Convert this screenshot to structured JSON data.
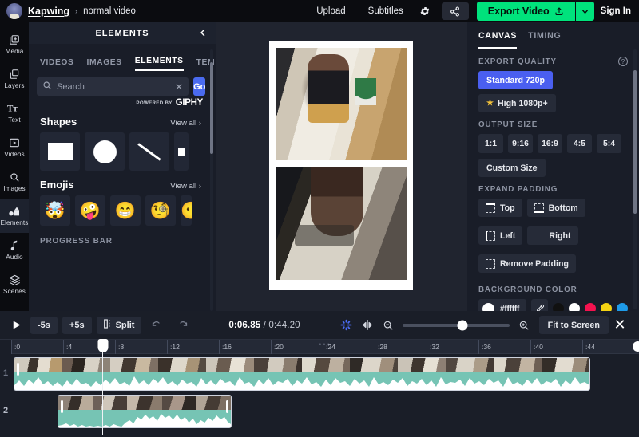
{
  "topbar": {
    "brand": "Kapwing",
    "separator": "›",
    "project_name": "normal video",
    "upload": "Upload",
    "subtitles": "Subtitles",
    "settings_icon": "gear-icon",
    "share_icon": "share-icon",
    "export_label": "Export Video",
    "export_icon": "export-upload-icon",
    "export_caret": "chevron-down-icon",
    "signin": "Sign In",
    "export_color": "#00e27c"
  },
  "rail": {
    "items": [
      {
        "label": "Media",
        "icon": "media-add-icon",
        "active": false
      },
      {
        "label": "Layers",
        "icon": "layers-icon",
        "active": false
      },
      {
        "label": "Text",
        "icon": "text-icon",
        "active": false
      },
      {
        "label": "Videos",
        "icon": "video-icon",
        "active": false
      },
      {
        "label": "Images",
        "icon": "image-search-icon",
        "active": false
      },
      {
        "label": "Elements",
        "icon": "elements-shapes-icon",
        "active": true
      },
      {
        "label": "Audio",
        "icon": "audio-note-icon",
        "active": false
      },
      {
        "label": "Scenes",
        "icon": "scenes-stack-icon",
        "active": false
      }
    ]
  },
  "panel": {
    "title": "ELEMENTS",
    "collapse_icon": "chevron-left-icon",
    "tabs": [
      {
        "label": "VIDEOS",
        "active": false
      },
      {
        "label": "IMAGES",
        "active": false
      },
      {
        "label": "ELEMENTS",
        "active": true
      },
      {
        "label": "TEM",
        "active": false
      }
    ],
    "search": {
      "placeholder": "Search",
      "value": "",
      "icon": "search-icon",
      "clear_icon": "close-icon",
      "go_label": "Go",
      "go_color": "#4a6bf0"
    },
    "attribution": {
      "prefix": "POWERED BY",
      "brand": "GIPHY"
    },
    "shapes": {
      "title": "Shapes",
      "view_all": "View all ›",
      "items": [
        "rectangle-shape",
        "circle-shape",
        "line-shape",
        "small-square-shape"
      ]
    },
    "emojis": {
      "title": "Emojis",
      "view_all": "View all ›",
      "items": [
        "🤯",
        "🤪",
        "😁",
        "🧐",
        "😶"
      ]
    },
    "progress_bar_label": "PROGRESS BAR"
  },
  "right": {
    "tabs": [
      {
        "label": "CANVAS",
        "active": true
      },
      {
        "label": "TIMING",
        "active": false
      }
    ],
    "export_quality": {
      "title": "EXPORT QUALITY",
      "help_icon": "question-mark-icon",
      "options": [
        {
          "label": "Standard 720p",
          "selected": true,
          "star": false
        },
        {
          "label": "High 1080p+",
          "selected": false,
          "star": true
        }
      ]
    },
    "output_size": {
      "title": "OUTPUT SIZE",
      "ratios": [
        "1:1",
        "9:16",
        "16:9",
        "4:5",
        "5:4"
      ],
      "custom": "Custom Size"
    },
    "expand_padding": {
      "title": "EXPAND PADDING",
      "buttons": [
        "Top",
        "Bottom",
        "Left",
        "Right",
        "Remove Padding"
      ]
    },
    "background_color": {
      "title": "BACKGROUND COLOR",
      "hex": "#ffffff",
      "eyedropper_icon": "eyedropper-icon",
      "swatches": [
        "#111111",
        "#ffffff",
        "#f5124f",
        "#f5d313",
        "#1e9be9"
      ]
    }
  },
  "timeline": {
    "play_icon": "play-icon",
    "back_label": "-5s",
    "forward_label": "+5s",
    "split_label": "Split",
    "split_icon": "split-icon",
    "undo_icon": "undo-icon",
    "redo_icon": "redo-icon",
    "current_time": "0:06.85",
    "total_time": "/ 0:44.20",
    "magnet_icon": "snap-magnet-icon",
    "mirror_icon": "flip-horizontal-icon",
    "zoom_out_icon": "zoom-out-icon",
    "zoom_in_icon": "zoom-in-icon",
    "zoom_value": 56,
    "fit_label": "Fit to Screen",
    "close_icon": "close-icon",
    "ruler_ticks": [
      ":0",
      ":4",
      ":8",
      ":12",
      ":16",
      ":20",
      ":24",
      ":28",
      ":32",
      ":36",
      ":40",
      ":44"
    ],
    "tracks": [
      {
        "number": "1",
        "start_pct": 0,
        "width_pct": 93.5
      },
      {
        "number": "2",
        "start_pct": 28.5,
        "width_pct": 29.5
      }
    ],
    "playhead_pct": 16.2,
    "wave_color": "#76c4b4"
  }
}
